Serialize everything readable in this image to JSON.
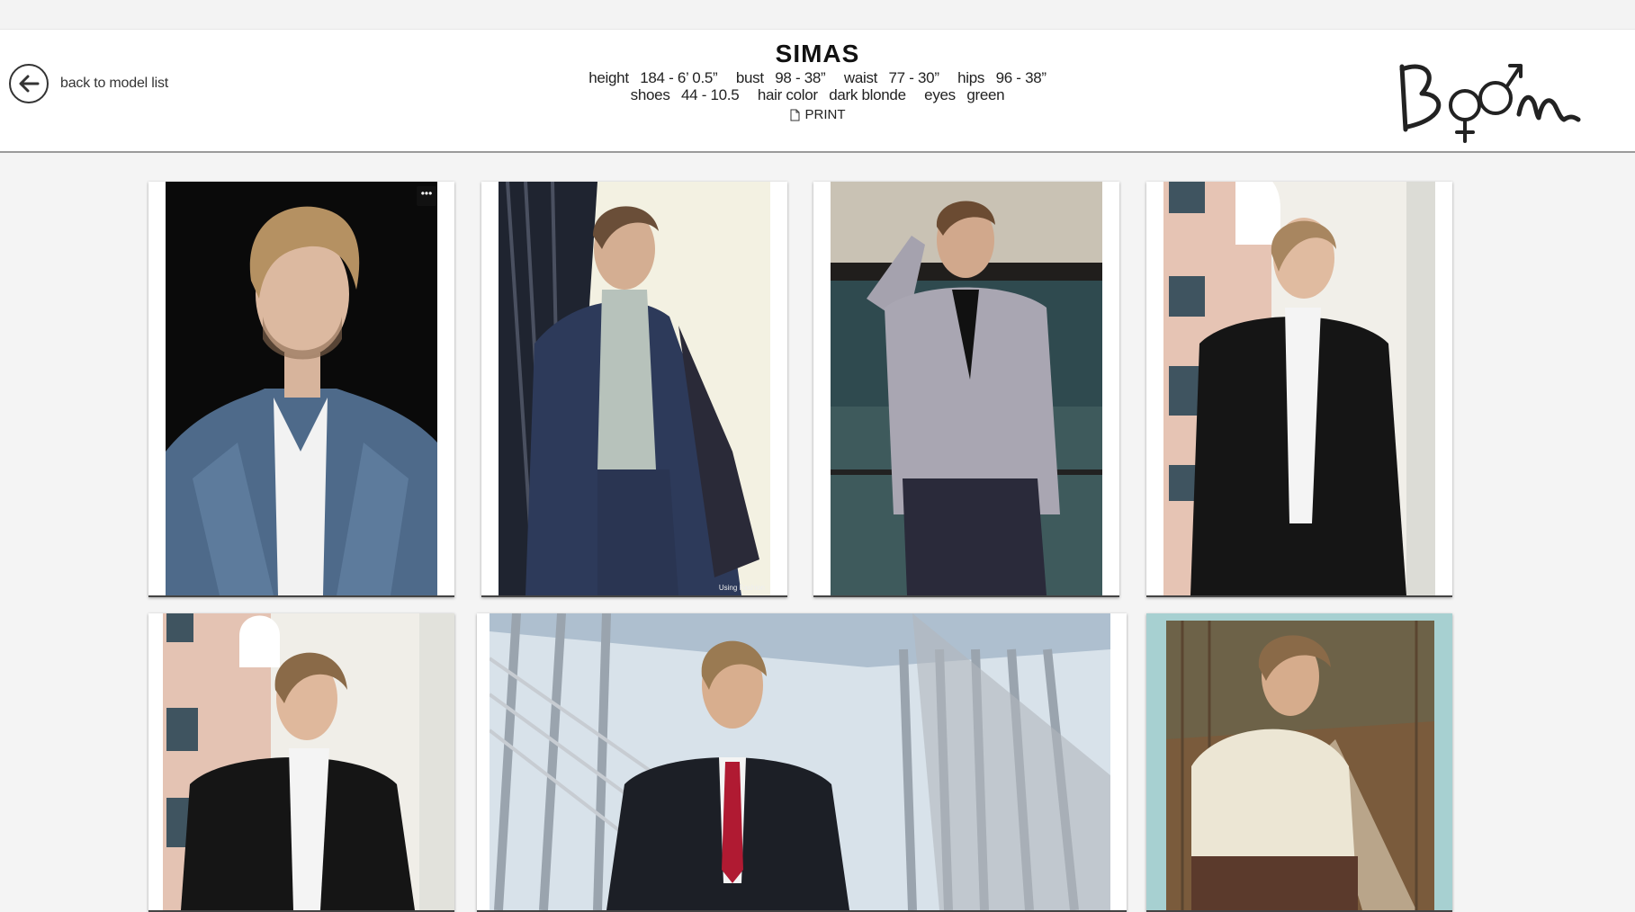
{
  "header": {
    "back_label": "back to model list",
    "model_name": "SIMAS",
    "stats_line1": [
      {
        "label": "height",
        "value": "184 - 6’ 0.5”"
      },
      {
        "label": "bust",
        "value": "98 - 38”"
      },
      {
        "label": "waist",
        "value": "77 - 30”"
      },
      {
        "label": "hips",
        "value": "96 - 38”"
      }
    ],
    "stats_line2": [
      {
        "label": "shoes",
        "value": "44 - 10.5"
      },
      {
        "label": "hair color",
        "value": "dark blonde"
      },
      {
        "label": "eyes",
        "value": "green"
      }
    ],
    "print_label": "PRINT",
    "logo_text": "Boom"
  },
  "gallery": {
    "more_label": "•••",
    "photo2_caption": "Using Fashion"
  },
  "colors": {
    "accent": "#111111",
    "background": "#f4f4f4"
  }
}
